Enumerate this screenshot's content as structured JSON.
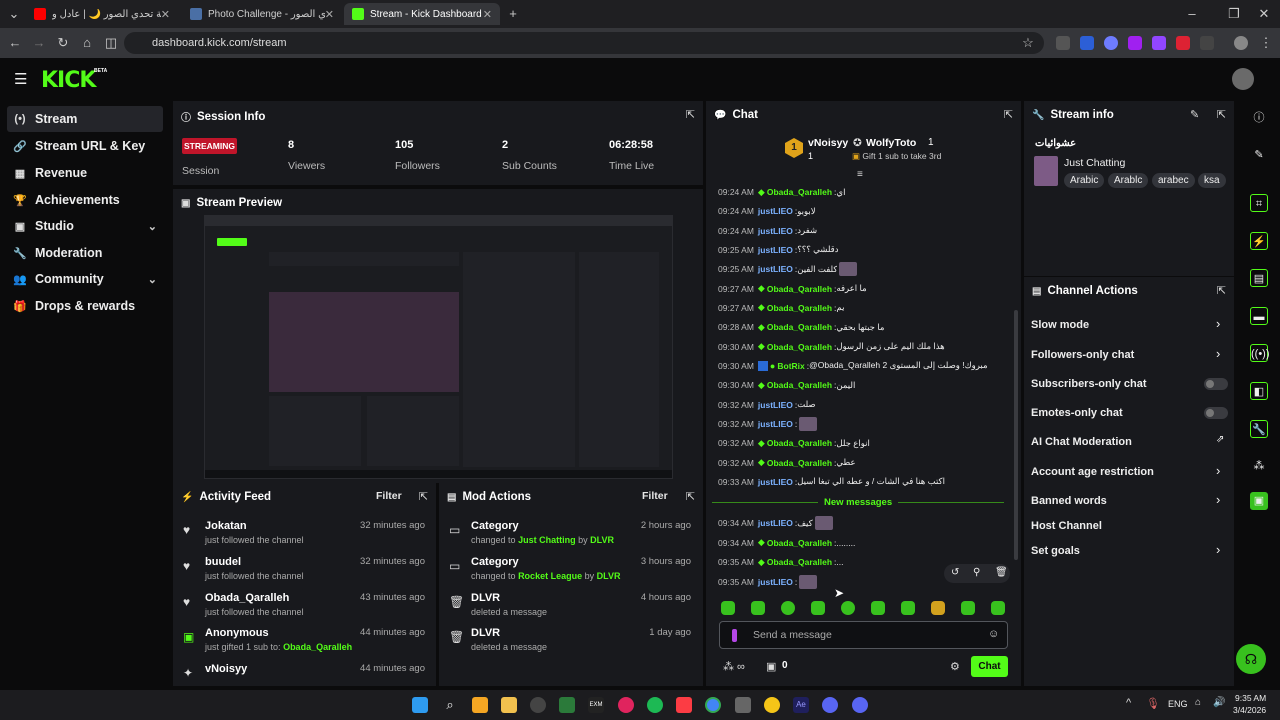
{
  "browser": {
    "tabs": [
      {
        "title": "بطولة تحدي الصور 🌙 | عادل و…"
      },
      {
        "title": "Photo Challenge - تحدي الصور"
      },
      {
        "title": "Stream - Kick Dashboard"
      }
    ],
    "url": "dashboard.kick.com/stream"
  },
  "app": {
    "logo": "KICK",
    "beta": "BETA"
  },
  "sidebar": {
    "items": [
      {
        "label": "Stream",
        "icon": "stream-icon"
      },
      {
        "label": "Stream URL & Key",
        "icon": "link-icon"
      },
      {
        "label": "Revenue",
        "icon": "revenue-icon"
      },
      {
        "label": "Achievements",
        "icon": "trophy-icon"
      },
      {
        "label": "Studio",
        "icon": "studio-icon"
      },
      {
        "label": "Moderation",
        "icon": "wrench-icon"
      },
      {
        "label": "Community",
        "icon": "community-icon"
      },
      {
        "label": "Drops & rewards",
        "icon": "gift-icon"
      }
    ]
  },
  "session": {
    "title": "Session Info",
    "status": "STREAMING",
    "session_label": "Session",
    "viewers": "8",
    "viewers_label": "Viewers",
    "followers": "105",
    "followers_label": "Followers",
    "subs": "2",
    "subs_label": "Sub Counts",
    "time": "06:28:58",
    "time_label": "Time Live"
  },
  "preview": {
    "title": "Stream Preview"
  },
  "activity": {
    "title": "Activity Feed",
    "filter": "Filter",
    "items": [
      {
        "name": "Jokatan",
        "sub": "just followed the channel",
        "time": "32 minutes ago"
      },
      {
        "name": "buudel",
        "sub": "just followed the channel",
        "time": "32 minutes ago"
      },
      {
        "name": "Obada_Qaralleh",
        "sub": "just followed the channel",
        "time": "43 minutes ago"
      },
      {
        "name": "Anonymous",
        "sub": "just gifted 1 sub to:",
        "target": "Obada_Qaralleh",
        "time": "44 minutes ago"
      },
      {
        "name": "vNoisyy",
        "sub": "",
        "time": "44 minutes ago"
      }
    ]
  },
  "mod": {
    "title": "Mod Actions",
    "filter": "Filter",
    "by": "by",
    "items": [
      {
        "name": "Category",
        "pre": "changed to",
        "target": "Just Chatting",
        "actor": "DLVR",
        "time": "2 hours ago"
      },
      {
        "name": "Category",
        "pre": "changed to",
        "target": "Rocket League",
        "actor": "DLVR",
        "time": "3 hours ago"
      },
      {
        "name": "DLVR",
        "pre": "deleted a message",
        "time": "4 hours ago"
      },
      {
        "name": "DLVR",
        "pre": "deleted a message",
        "time": "1 day ago"
      }
    ]
  },
  "chat": {
    "title": "Chat",
    "top1": {
      "name": "vNoisyy",
      "count": "1"
    },
    "top2": {
      "name": "WolfyToto",
      "count": "1"
    },
    "gift_hint": "Gift 1 sub to take 3rd",
    "new_messages": "New messages",
    "messages": [
      {
        "time": "09:24 AM",
        "user": "Obada_Qaralleh",
        "badge": true,
        "text": "اي"
      },
      {
        "time": "09:24 AM",
        "user": "justLIEO",
        "text": "لابوبو"
      },
      {
        "time": "09:24 AM",
        "user": "justLIEO",
        "text": "شفرد"
      },
      {
        "time": "09:25 AM",
        "user": "justLIEO",
        "text": "دقلشي ؟؟؟"
      },
      {
        "time": "09:25 AM",
        "user": "justLIEO",
        "text": "كلفت الفين",
        "img": true
      },
      {
        "time": "09:27 AM",
        "user": "Obada_Qaralleh",
        "badge": true,
        "text": "ما اعرفه"
      },
      {
        "time": "09:27 AM",
        "user": "Obada_Qaralleh",
        "badge": true,
        "text": "يم"
      },
      {
        "time": "09:28 AM",
        "user": "Obada_Qaralleh",
        "badge": true,
        "text": "ما جبتها بحقي"
      },
      {
        "time": "09:30 AM",
        "user": "Obada_Qaralleh",
        "badge": true,
        "text": "هذا ملك اليم على زمن الرسول"
      },
      {
        "time": "09:30 AM",
        "user": "BotRix",
        "bot": true,
        "text": "@Obada_Qaralleh مبروك! وصلت إلى المستوى 2"
      },
      {
        "time": "09:30 AM",
        "user": "Obada_Qaralleh",
        "badge": true,
        "text": "اليمن"
      },
      {
        "time": "09:32 AM",
        "user": "justLIEO",
        "text": "صلت"
      },
      {
        "time": "09:32 AM",
        "user": "justLIEO",
        "text": "",
        "img": true
      },
      {
        "time": "09:32 AM",
        "user": "Obada_Qaralleh",
        "badge": true,
        "text": "انواع جلل"
      },
      {
        "time": "09:32 AM",
        "user": "Obada_Qaralleh",
        "badge": true,
        "text": "عطي"
      },
      {
        "time": "09:33 AM",
        "user": "justLIEO",
        "text": "اكتب هنا في الشات / و عطه الي تبغا اسيل"
      },
      {
        "time": "09:34 AM",
        "user": "justLIEO",
        "text": "كيف",
        "img": true
      },
      {
        "time": "09:34 AM",
        "user": "Obada_Qaralleh",
        "badge": true,
        "text": "........"
      },
      {
        "time": "09:35 AM",
        "user": "Obada_Qaralleh",
        "badge": true,
        "text": "..."
      },
      {
        "time": "09:35 AM",
        "user": "justLIEO",
        "text": "",
        "img": true
      }
    ],
    "input_placeholder": "Send a message",
    "gift_count": "0",
    "send_label": "Chat"
  },
  "stream_info": {
    "title": "Stream info",
    "stream_title": "عشوائيات",
    "category": "Just Chatting",
    "tags": [
      "Arabic",
      "Arablc",
      "arabec",
      "ksa"
    ]
  },
  "channel_actions": {
    "title": "Channel Actions",
    "items": [
      {
        "label": "Slow mode",
        "ctrl": "chevron"
      },
      {
        "label": "Followers-only chat",
        "ctrl": "chevron"
      },
      {
        "label": "Subscribers-only chat",
        "ctrl": "toggle"
      },
      {
        "label": "Emotes-only chat",
        "ctrl": "toggle"
      },
      {
        "label": "AI Chat Moderation",
        "ctrl": "external"
      },
      {
        "label": "Account age restriction",
        "ctrl": "chevron"
      },
      {
        "label": "Banned words",
        "ctrl": "chevron"
      },
      {
        "label": "Host Channel",
        "ctrl": "none"
      },
      {
        "label": "Set goals",
        "ctrl": "chevron"
      }
    ]
  },
  "taskbar": {
    "lang": "ENG",
    "time": "9:35 AM",
    "date": "3/4/2026"
  },
  "colors": {
    "accent": "#53fc18",
    "live": "#c0152a",
    "panel": "#18191d"
  }
}
